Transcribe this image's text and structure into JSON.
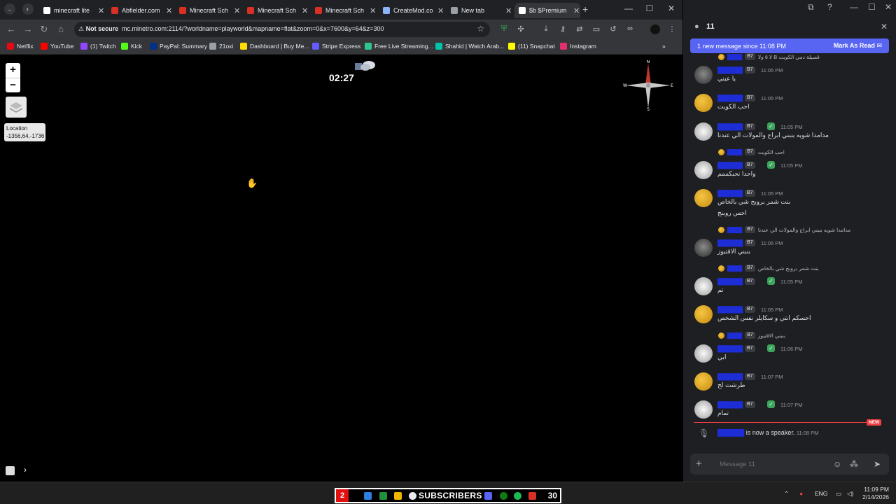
{
  "browser": {
    "tabs": [
      {
        "label": "minecraft lite",
        "fav_color": "#ffffff"
      },
      {
        "label": "Abfielder.com",
        "fav_color": "#d93025"
      },
      {
        "label": "Minecraft Sch",
        "fav_color": "#d93025"
      },
      {
        "label": "Minecraft Sch",
        "fav_color": "#d93025"
      },
      {
        "label": "Minecraft Sch",
        "fav_color": "#d93025"
      },
      {
        "label": "CreateMod.co",
        "fav_color": "#8ab4f8"
      },
      {
        "label": "New tab",
        "fav_color": "#9aa0a6"
      },
      {
        "label": "$b $Premium",
        "fav_color": "#ffffff",
        "active": true
      }
    ],
    "security_label": "Not secure",
    "url": "mc.minetro.com:2114/?worldname=playworld&mapname=flat&zoom=0&x=7600&y=64&z=300",
    "bookmarks": [
      {
        "label": "Netflix",
        "color": "#e50914"
      },
      {
        "label": "YouTube",
        "color": "#ff0000"
      },
      {
        "label": "(1) Twitch",
        "color": "#9146ff"
      },
      {
        "label": "Kick",
        "color": "#53fc18"
      },
      {
        "label": "PayPal: Summary",
        "color": "#003087"
      },
      {
        "label": "21oxi",
        "color": "#9aa0a6"
      },
      {
        "label": "Dashboard | Buy Me...",
        "color": "#ffdd00"
      },
      {
        "label": "Stripe Express",
        "color": "#635bff"
      },
      {
        "label": "Free Live Streaming...",
        "color": "#31c48d"
      },
      {
        "label": "Shahid | Watch Arab...",
        "color": "#00c2a8"
      },
      {
        "label": "(11) Snapchat",
        "color": "#fffc00"
      },
      {
        "label": "Instagram",
        "color": "#e1306c"
      }
    ]
  },
  "map": {
    "zoom_in": "+",
    "zoom_out": "−",
    "location_label": "Location",
    "location_value": "-1356,64,-1736",
    "clock": "02:27",
    "compass": {
      "n": "N",
      "s": "S",
      "e": "E",
      "w": "W"
    }
  },
  "chat": {
    "channel_count": "11",
    "new_messages_text": "1 new message since 11:08 PM",
    "mark_as_read": "Mark As Read",
    "badge_tag": "B7",
    "messages": [
      {
        "reply": "لا ٥ ولا B قصيلة دمي الكويت",
        "name": "",
        "time": "11:05 PM",
        "text": "يا عيني",
        "avatar": "dark"
      },
      {
        "reply": "",
        "name": "",
        "time": "11:05 PM",
        "text": "احب الكويت",
        "avatar": "gold"
      },
      {
        "reply": "",
        "name": "",
        "time": "11:05 PM",
        "text": "مدامدا شويه بنبني ابراج والمولات الي عندنا",
        "avatar": "white"
      },
      {
        "reply": "احب الكويت",
        "name": "",
        "time": "11:05 PM",
        "text": "واحدا نحبكممم",
        "avatar": "white"
      },
      {
        "reply": "",
        "name": "",
        "time": "11:05 PM",
        "text": "بنت شمر بروبح شي بالخاص",
        "text2": "احس روبنج",
        "avatar": "gold"
      },
      {
        "reply": "مدامدا شويه بنبني ابراج والمولات الي عندنا",
        "name": "",
        "time": "11:05 PM",
        "text": "بنبني الاقتيوز",
        "avatar": "dark"
      },
      {
        "reply": "بنت شمر بروبح شي بالخاص",
        "name": "",
        "time": "11:05 PM",
        "text": "تم",
        "avatar": "white"
      },
      {
        "reply": "",
        "name": "",
        "time": "11:05 PM",
        "text": "احسكم انتي و سكايلر نفس الشخص",
        "avatar": "gold"
      },
      {
        "reply": "بنبني الاقتيوز",
        "name": "",
        "time": "11:06 PM",
        "text": "ابي",
        "avatar": "white"
      },
      {
        "reply": "",
        "name": "",
        "time": "11:07 PM",
        "text": "طرشت لج",
        "avatar": "gold"
      },
      {
        "reply": "",
        "name": "",
        "time": "11:07 PM",
        "text": "تمام",
        "avatar": "white"
      }
    ],
    "new_tag": "NEW",
    "system_message": "is now a speaker.",
    "system_time": "11:08 PM",
    "composer_placeholder": "Message 11"
  },
  "taskbar": {
    "sub_left": "2",
    "sub_text": "SUBSCRIBERS",
    "sub_right": "30",
    "lang": "ENG",
    "time": "11:09 PM",
    "date": "2/14/2026"
  }
}
